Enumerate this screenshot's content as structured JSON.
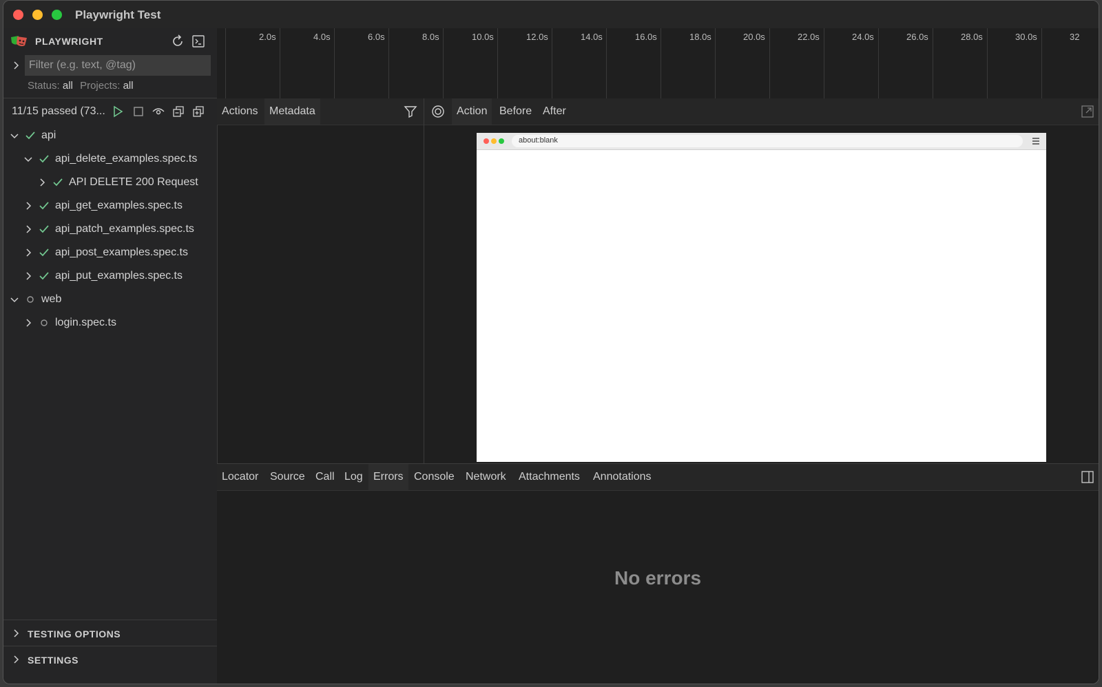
{
  "window": {
    "title": "Playwright Test"
  },
  "sidebar": {
    "title": "PLAYWRIGHT",
    "filter_placeholder": "Filter (e.g. text, @tag)",
    "status_label": "Status:",
    "status_value": "all",
    "projects_label": "Projects:",
    "projects_value": "all",
    "summary": "11/15 passed (73...",
    "tree": [
      {
        "label": "api",
        "status": "passed",
        "expanded": true
      },
      {
        "label": "api_delete_examples.spec.ts",
        "status": "passed",
        "expanded": true
      },
      {
        "label": "API DELETE 200 Request",
        "status": "passed",
        "expanded": false
      },
      {
        "label": "api_get_examples.spec.ts",
        "status": "passed",
        "expanded": false
      },
      {
        "label": "api_patch_examples.spec.ts",
        "status": "passed",
        "expanded": false
      },
      {
        "label": "api_post_examples.spec.ts",
        "status": "passed",
        "expanded": false
      },
      {
        "label": "api_put_examples.spec.ts",
        "status": "passed",
        "expanded": false
      },
      {
        "label": "web",
        "status": "not-run",
        "expanded": true
      },
      {
        "label": "login.spec.ts",
        "status": "not-run",
        "expanded": false
      }
    ],
    "sections": [
      "TESTING OPTIONS",
      "SETTINGS"
    ]
  },
  "timeline": {
    "ticks": [
      "2.0s",
      "4.0s",
      "6.0s",
      "8.0s",
      "10.0s",
      "12.0s",
      "14.0s",
      "16.0s",
      "18.0s",
      "20.0s",
      "22.0s",
      "24.0s",
      "26.0s",
      "28.0s",
      "30.0s",
      "32"
    ]
  },
  "actions_tabs": [
    "Actions",
    "Metadata"
  ],
  "snapshot_tabs": [
    "Action",
    "Before",
    "After"
  ],
  "snapshot": {
    "url": "about:blank"
  },
  "bottom_tabs": [
    "Locator",
    "Source",
    "Call",
    "Log",
    "Errors",
    "Console",
    "Network",
    "Attachments",
    "Annotations"
  ],
  "bottom_active_tab": "Errors",
  "errors_message": "No errors",
  "colors": {
    "pass": "#73c991",
    "background": "#1f1f1f",
    "sidebar": "#252526"
  }
}
